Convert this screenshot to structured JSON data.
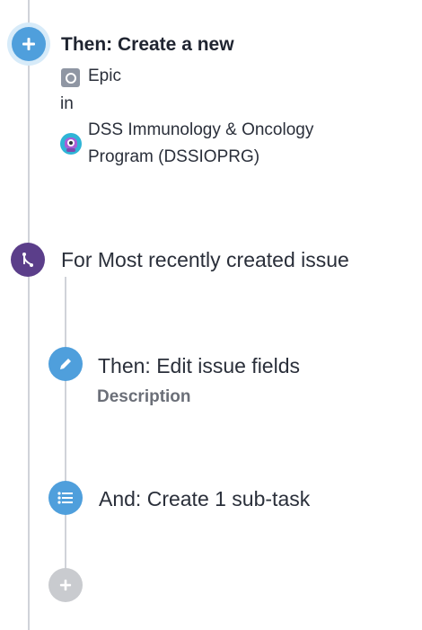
{
  "create_action": {
    "title": "Then: Create a new",
    "issue_type": "Epic",
    "in_label": "in",
    "project_line1": "DSS Immunology & Oncology",
    "project_line2": "Program (DSSIOPRG)",
    "icon": "plus-icon",
    "icon_color": "#4f9fdc"
  },
  "branch": {
    "label": "For Most recently created issue",
    "icon": "branch-icon",
    "icon_color": "#5b3e8a"
  },
  "edit_action": {
    "label": "Then: Edit issue fields",
    "field": "Description",
    "icon": "pencil-icon",
    "icon_color": "#4f9fdc"
  },
  "subtask_action": {
    "label": "And: Create 1 sub-task",
    "icon": "list-icon",
    "icon_color": "#4f9fdc"
  },
  "add_component": {
    "icon": "plus-icon",
    "icon_color": "#c9cbcf"
  }
}
